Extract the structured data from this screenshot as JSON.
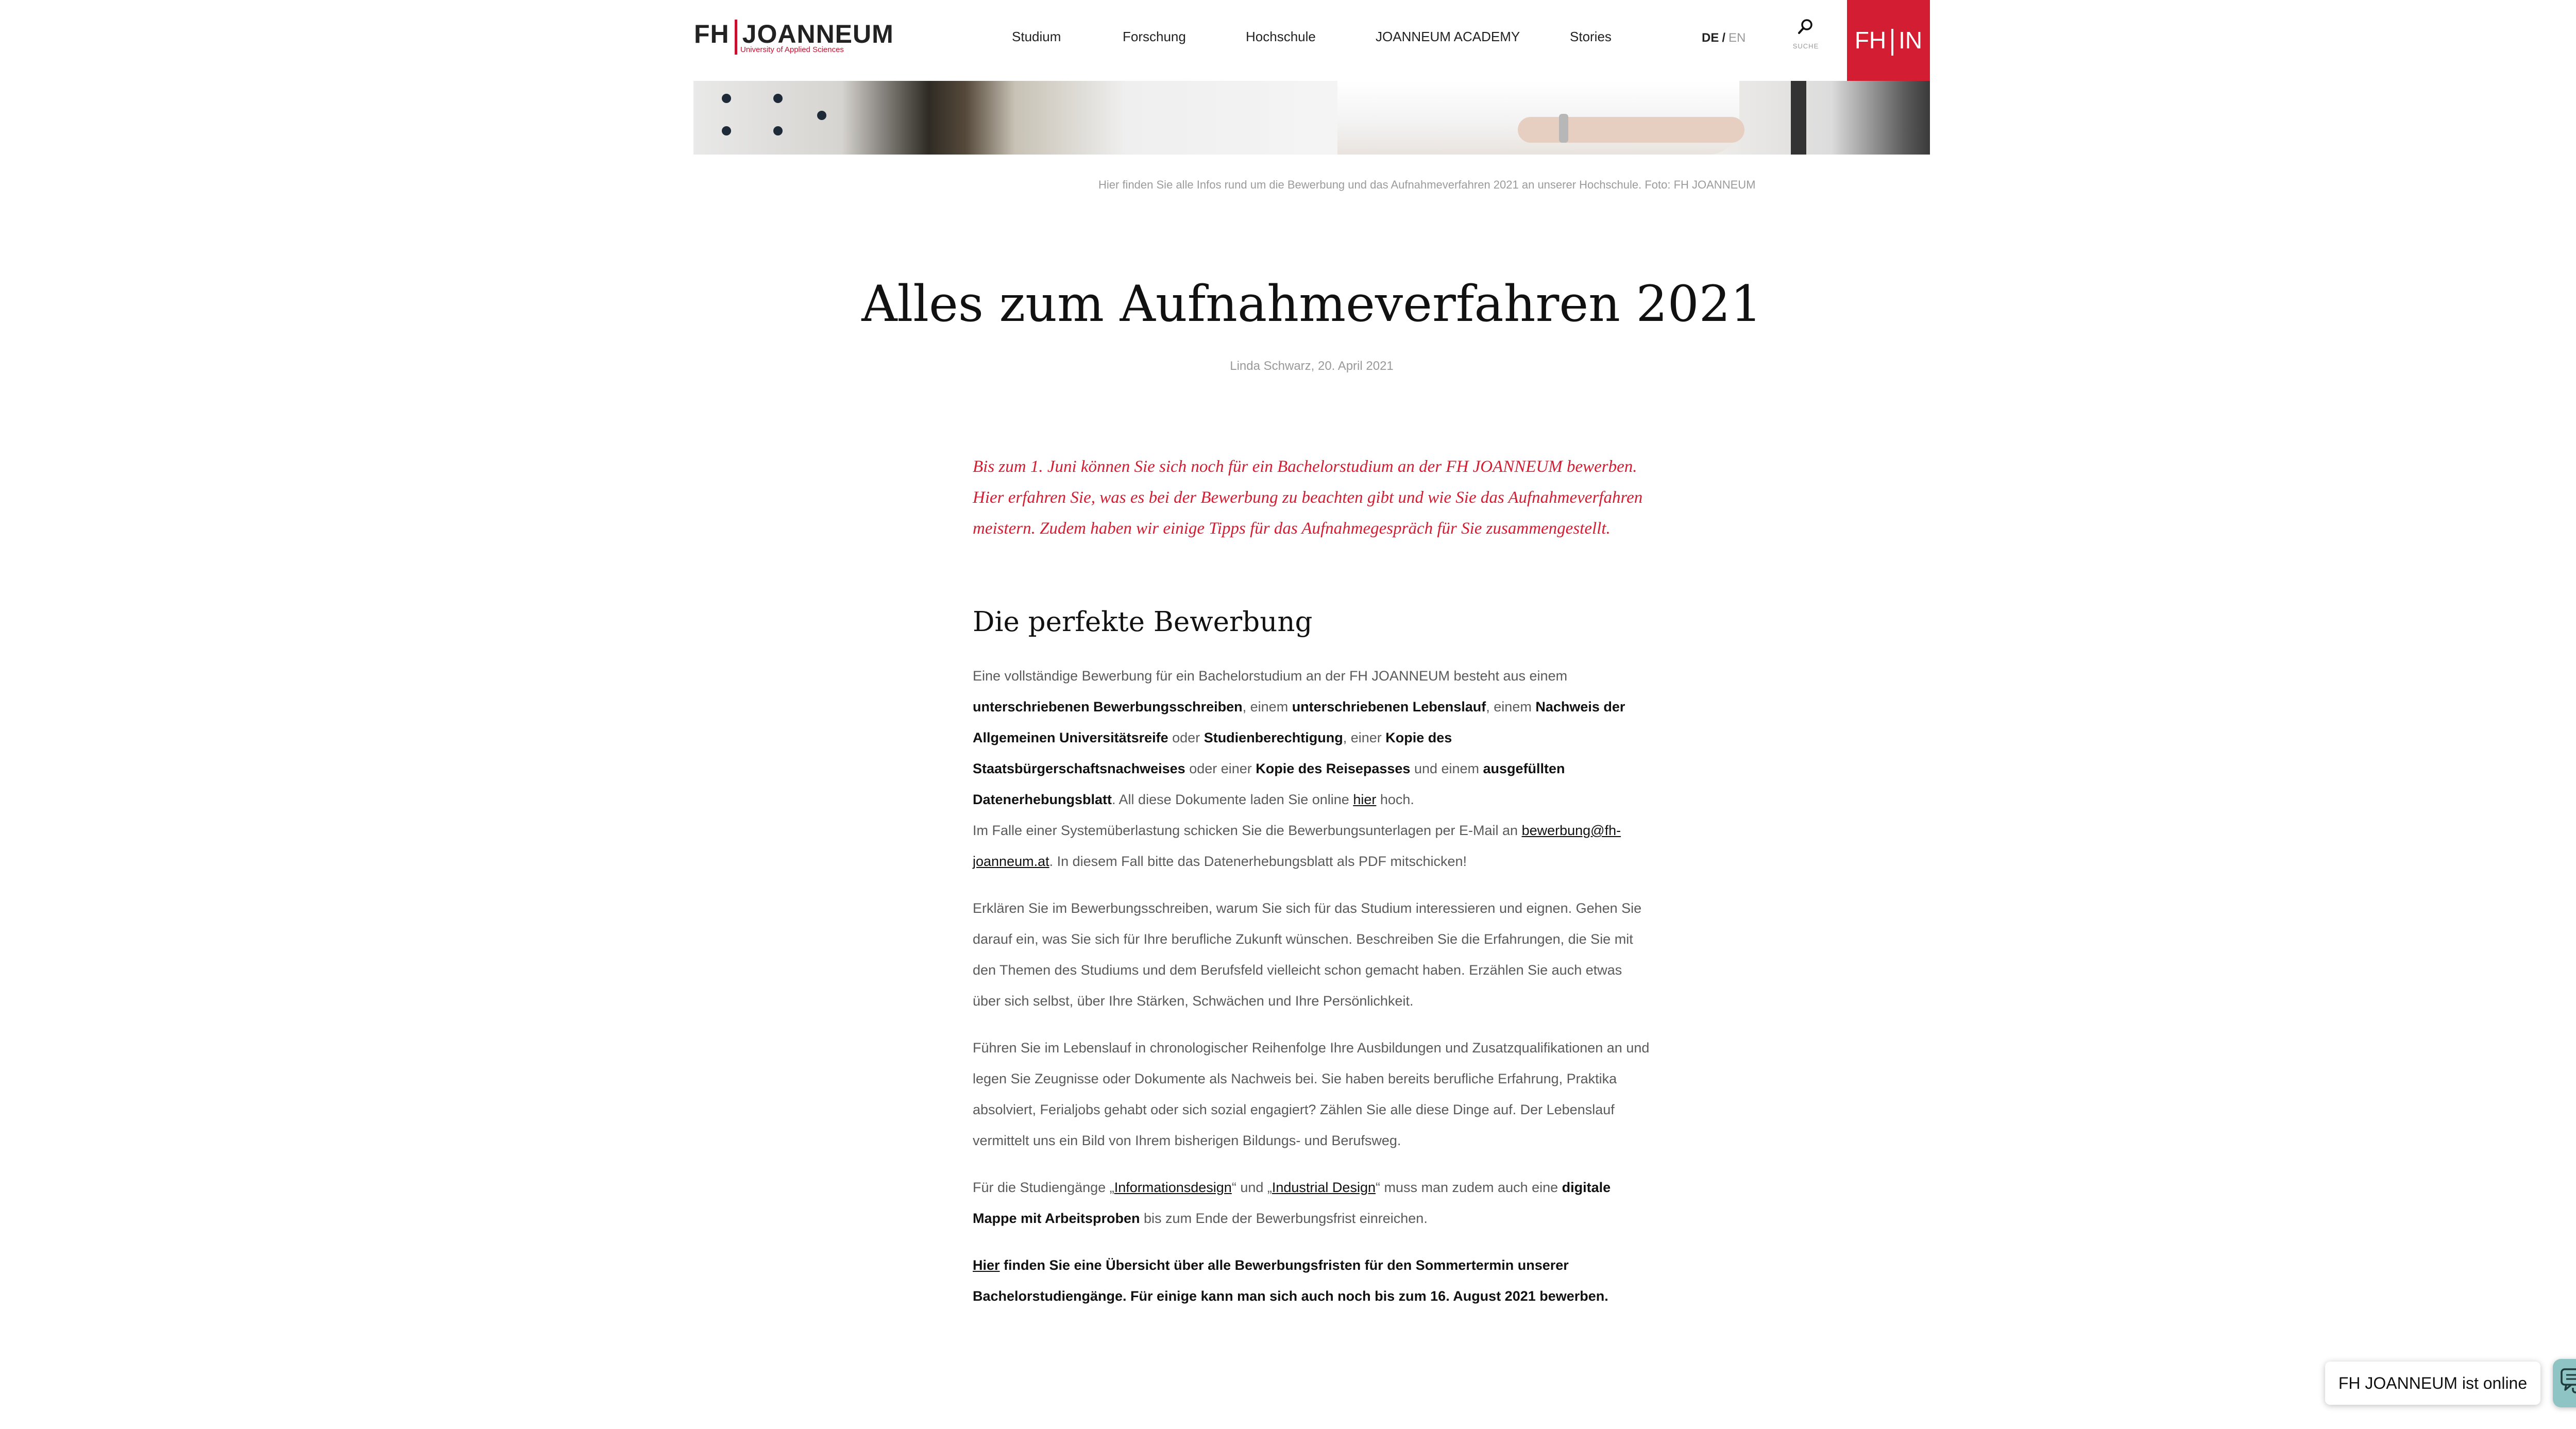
{
  "header": {
    "logo_main": "FH JOANNEUM",
    "logo_fh": "FH",
    "logo_joanneum": "JOANNEUM",
    "logo_sub": "University of Applied Sciences",
    "nav": [
      "Studium",
      "Forschung",
      "Hochschule",
      "JOANNEUM ACADEMY",
      "Stories"
    ],
    "lang_de": "DE",
    "lang_sep": "/",
    "lang_en": "EN",
    "search_label": "SUCHE",
    "fhin_left": "FH",
    "fhin_right": "IN",
    "accent": "#d21d33"
  },
  "hero": {
    "caption": "Hier finden Sie alle Infos rund um die Bewerbung und das Aufnahmeverfahren 2021 an unserer Hochschule. Foto: FH JOANNEUM"
  },
  "article": {
    "title": "Alles zum Aufnahmeverfahren 2021",
    "byline": "Linda Schwarz, 20. April 2021",
    "lead": "Bis zum 1. Juni können Sie sich noch für ein Bachelorstudium an der FH JOANNEUM bewerben. Hier erfahren Sie, was es bei der Bewerbung zu beachten gibt und wie Sie das Aufnahmeverfahren meistern. Zudem haben wir einige Tipps für das Aufnahmegespräch für Sie zusammengestellt.",
    "section_heading": "Die perfekte Bewerbung",
    "p1": {
      "t1": "Eine vollständige Bewerbung für ein Bachelorstudium an der FH JOANNEUM besteht aus einem ",
      "b1": "unterschriebenen Bewerbungsschreiben",
      "t2": ", einem ",
      "b2": "unterschriebenen Lebenslauf",
      "t3": ", einem ",
      "b3": "Nachweis der Allgemeinen Universitätsreife",
      "t4": " oder ",
      "b4": "Studienberechtigung",
      "t5": ", einer ",
      "b5": "Kopie des Staatsbürgerschaftsnachweises",
      "t6": " oder einer ",
      "b6": "Kopie des Reisepasses",
      "t7": " und einem ",
      "b7": "ausgefüllten Datenerhebungsblatt",
      "t8": ". All diese Dokumente laden Sie online ",
      "link": "hier",
      "t9": " hoch."
    },
    "p2": {
      "t1": "Im Falle einer Systemüberlastung schicken Sie die Bewerbungsunterlagen per E-Mail an ",
      "email": "bewerbung@fh-joanneum.at",
      "t2": ". In diesem Fall bitte das Datenerhebungsblatt als PDF mitschicken!"
    },
    "p3": "Erklären Sie im Bewerbungsschreiben, warum Sie sich für das Studium interessieren und eignen. Gehen Sie darauf ein, was Sie sich für Ihre berufliche Zukunft wünschen. Beschreiben Sie die Erfahrungen, die Sie mit den Themen des Studiums und dem Berufsfeld vielleicht schon gemacht haben. Erzählen Sie auch etwas über sich selbst, über Ihre Stärken, Schwächen und Ihre Persönlichkeit.",
    "p4": "Führen Sie im Lebenslauf in chronologischer Reihenfolge Ihre Ausbildungen und Zusatzqualifikationen an und legen Sie Zeugnisse oder Dokumente als Nachweis bei. Sie haben bereits berufliche Erfahrung, Praktika absolviert, Ferialjobs gehabt oder sich sozial engagiert? Zählen Sie alle diese Dinge auf. Der Lebenslauf vermittelt uns ein Bild von Ihrem bisherigen Bildungs- und Berufsweg.",
    "p5": {
      "t1": "Für die Studiengänge „",
      "link1": "Informationsdesign",
      "t2": "“ und „",
      "link2": "Industrial Design",
      "t3": "“ muss man zudem auch eine ",
      "b1": "digitale Mappe mit Arbeitsproben",
      "t4": " bis zum Ende der Bewerbungsfrist einreichen."
    },
    "p6": {
      "link": "Hier",
      "b1": " finden Sie eine Übersicht über alle Bewerbungsfristen für den Sommertermin unserer Bachelorstudiengänge. Für einige kann man sich auch noch bis zum 16. August 2021 bewerben."
    }
  },
  "chat": {
    "label": "FH JOANNEUM ist online",
    "icon": "chat-bubbles-icon",
    "button_color": "#8fc4c4"
  }
}
